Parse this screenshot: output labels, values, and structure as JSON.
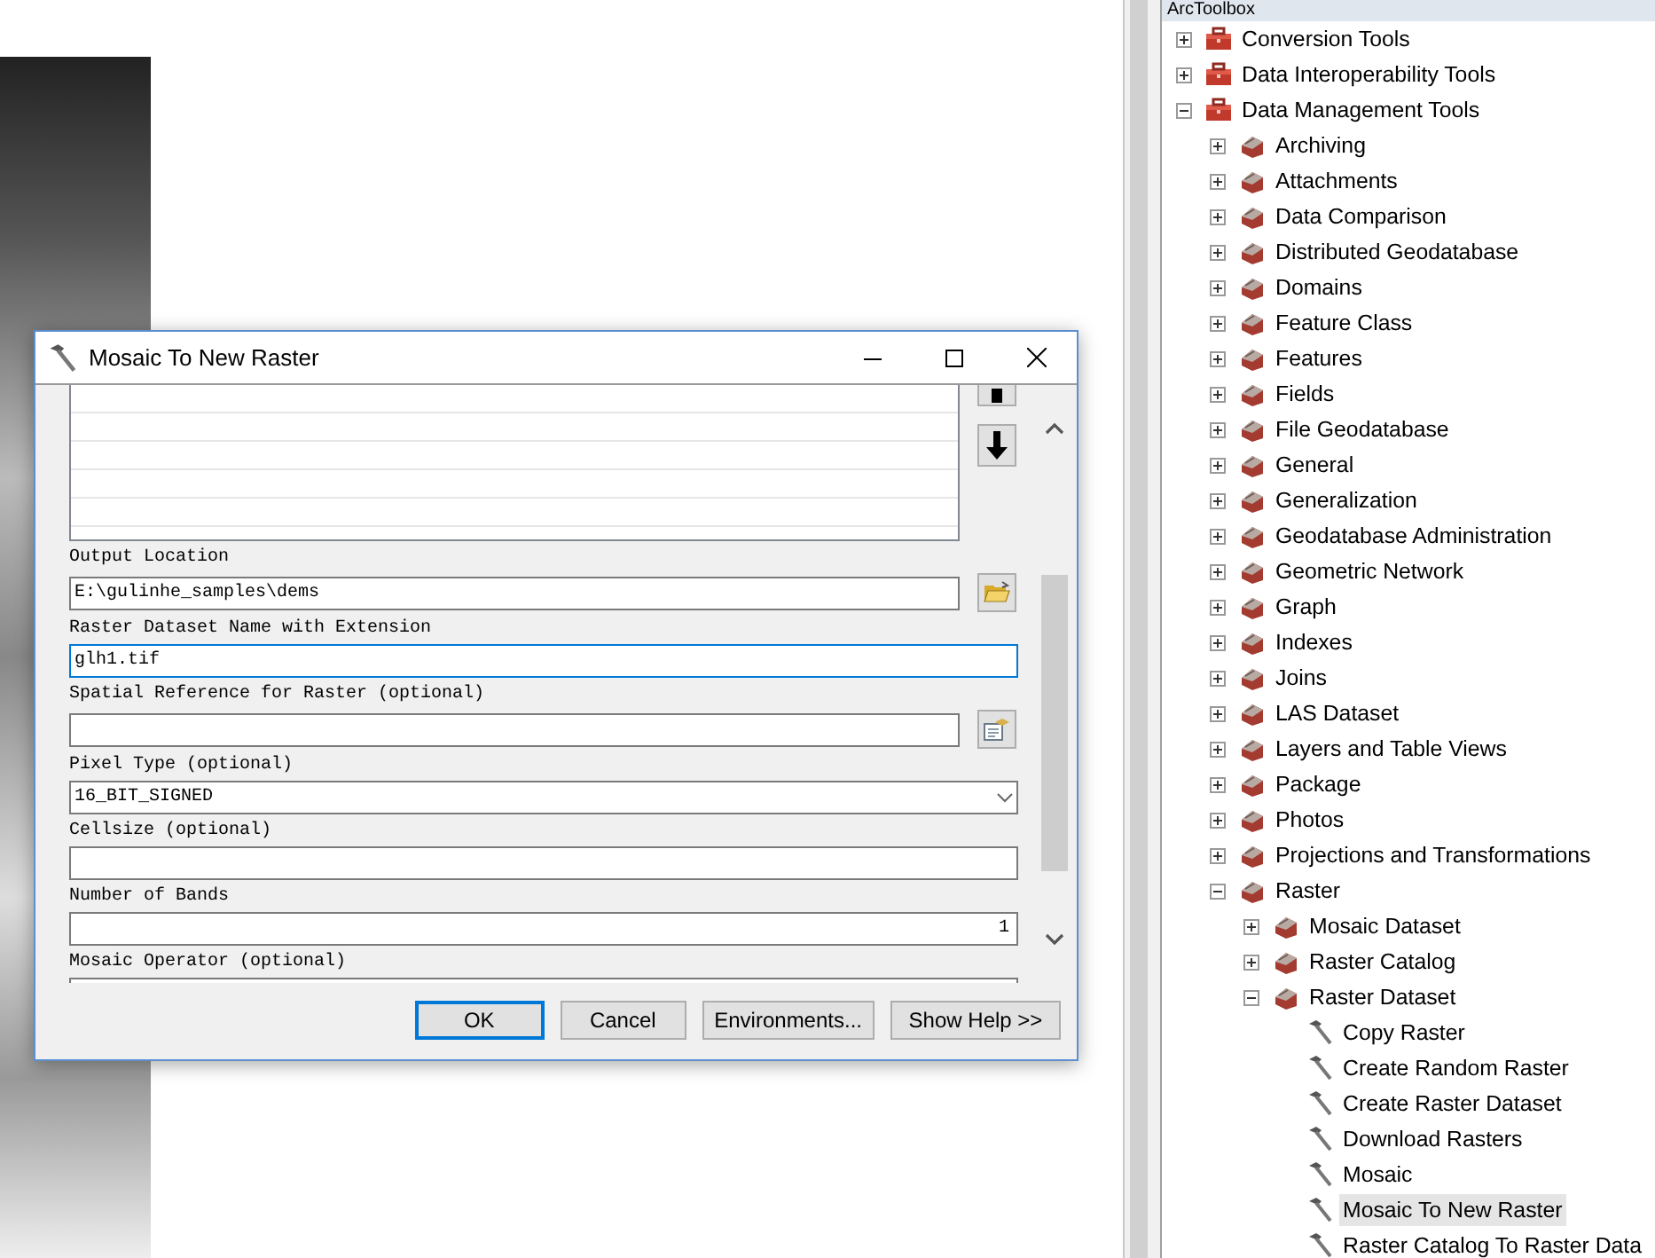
{
  "dialog": {
    "title": "Mosaic To New Raster",
    "parameters": [
      {
        "label": "Output Location",
        "value": "E:\\gulinhe_samples\\dems",
        "kind": "folder",
        "focused": false
      },
      {
        "label": "Raster Dataset Name with Extension",
        "value": "glh1.tif",
        "kind": "text",
        "focused": true
      },
      {
        "label": "Spatial Reference for Raster (optional)",
        "kind": "spatial",
        "focused": false
      },
      {
        "label": "Pixel Type (optional)",
        "value": "16_BIT_SIGNED",
        "kind": "dropdown",
        "focused": false
      },
      {
        "label": "Cellsize (optional)",
        "kind": "text",
        "focused": false
      },
      {
        "label": "Number of Bands",
        "value": "1",
        "kind": "number",
        "focused": false
      },
      {
        "label": "Mosaic Operator (optional)",
        "kind": "text",
        "focused": false
      }
    ],
    "buttons": [
      {
        "label": "OK",
        "default": true
      },
      {
        "label": "Cancel",
        "default": false
      },
      {
        "label": "Environments...",
        "default": false
      },
      {
        "label": "Show Help >>",
        "default": false
      }
    ]
  },
  "toolbox": {
    "title": "ArcToolbox",
    "items": [
      {
        "label": "Conversion Tools",
        "kind": "toolbox",
        "expanded": false,
        "selected": false
      },
      {
        "label": "Data Interoperability Tools",
        "kind": "toolbox",
        "expanded": false,
        "selected": false
      },
      {
        "label": "Data Management Tools",
        "kind": "toolbox",
        "expanded": true,
        "selected": false,
        "children": [
          {
            "label": "Archiving",
            "kind": "toolset",
            "expanded": false,
            "selected": false
          },
          {
            "label": "Attachments",
            "kind": "toolset",
            "expanded": false,
            "selected": false
          },
          {
            "label": "Data Comparison",
            "kind": "toolset",
            "expanded": false,
            "selected": false
          },
          {
            "label": "Distributed Geodatabase",
            "kind": "toolset",
            "expanded": false,
            "selected": false
          },
          {
            "label": "Domains",
            "kind": "toolset",
            "expanded": false,
            "selected": false
          },
          {
            "label": "Feature Class",
            "kind": "toolset",
            "expanded": false,
            "selected": false
          },
          {
            "label": "Features",
            "kind": "toolset",
            "expanded": false,
            "selected": false
          },
          {
            "label": "Fields",
            "kind": "toolset",
            "expanded": false,
            "selected": false
          },
          {
            "label": "File Geodatabase",
            "kind": "toolset",
            "expanded": false,
            "selected": false
          },
          {
            "label": "General",
            "kind": "toolset",
            "expanded": false,
            "selected": false
          },
          {
            "label": "Generalization",
            "kind": "toolset",
            "expanded": false,
            "selected": false
          },
          {
            "label": "Geodatabase Administration",
            "kind": "toolset",
            "expanded": false,
            "selected": false
          },
          {
            "label": "Geometric Network",
            "kind": "toolset",
            "expanded": false,
            "selected": false
          },
          {
            "label": "Graph",
            "kind": "toolset",
            "expanded": false,
            "selected": false
          },
          {
            "label": "Indexes",
            "kind": "toolset",
            "expanded": false,
            "selected": false
          },
          {
            "label": "Joins",
            "kind": "toolset",
            "expanded": false,
            "selected": false
          },
          {
            "label": "LAS Dataset",
            "kind": "toolset",
            "expanded": false,
            "selected": false
          },
          {
            "label": "Layers and Table Views",
            "kind": "toolset",
            "expanded": false,
            "selected": false
          },
          {
            "label": "Package",
            "kind": "toolset",
            "expanded": false,
            "selected": false
          },
          {
            "label": "Photos",
            "kind": "toolset",
            "expanded": false,
            "selected": false
          },
          {
            "label": "Projections and Transformations",
            "kind": "toolset",
            "expanded": false,
            "selected": false
          },
          {
            "label": "Raster",
            "kind": "toolset",
            "expanded": true,
            "selected": false,
            "children": [
              {
                "label": "Mosaic Dataset",
                "kind": "toolset",
                "expanded": false,
                "selected": false
              },
              {
                "label": "Raster Catalog",
                "kind": "toolset",
                "expanded": false,
                "selected": false
              },
              {
                "label": "Raster Dataset",
                "kind": "toolset",
                "expanded": true,
                "selected": false,
                "children": [
                  {
                    "label": "Copy Raster",
                    "kind": "tool",
                    "selected": false
                  },
                  {
                    "label": "Create Random Raster",
                    "kind": "tool",
                    "selected": false
                  },
                  {
                    "label": "Create Raster Dataset",
                    "kind": "tool",
                    "selected": false
                  },
                  {
                    "label": "Download Rasters",
                    "kind": "tool",
                    "selected": false
                  },
                  {
                    "label": "Mosaic",
                    "kind": "tool",
                    "selected": false
                  },
                  {
                    "label": "Mosaic To New Raster",
                    "kind": "tool",
                    "selected": true
                  },
                  {
                    "label": "Raster Catalog To Raster Data",
                    "kind": "tool",
                    "selected": false
                  }
                ]
              }
            ]
          }
        ]
      }
    ]
  }
}
